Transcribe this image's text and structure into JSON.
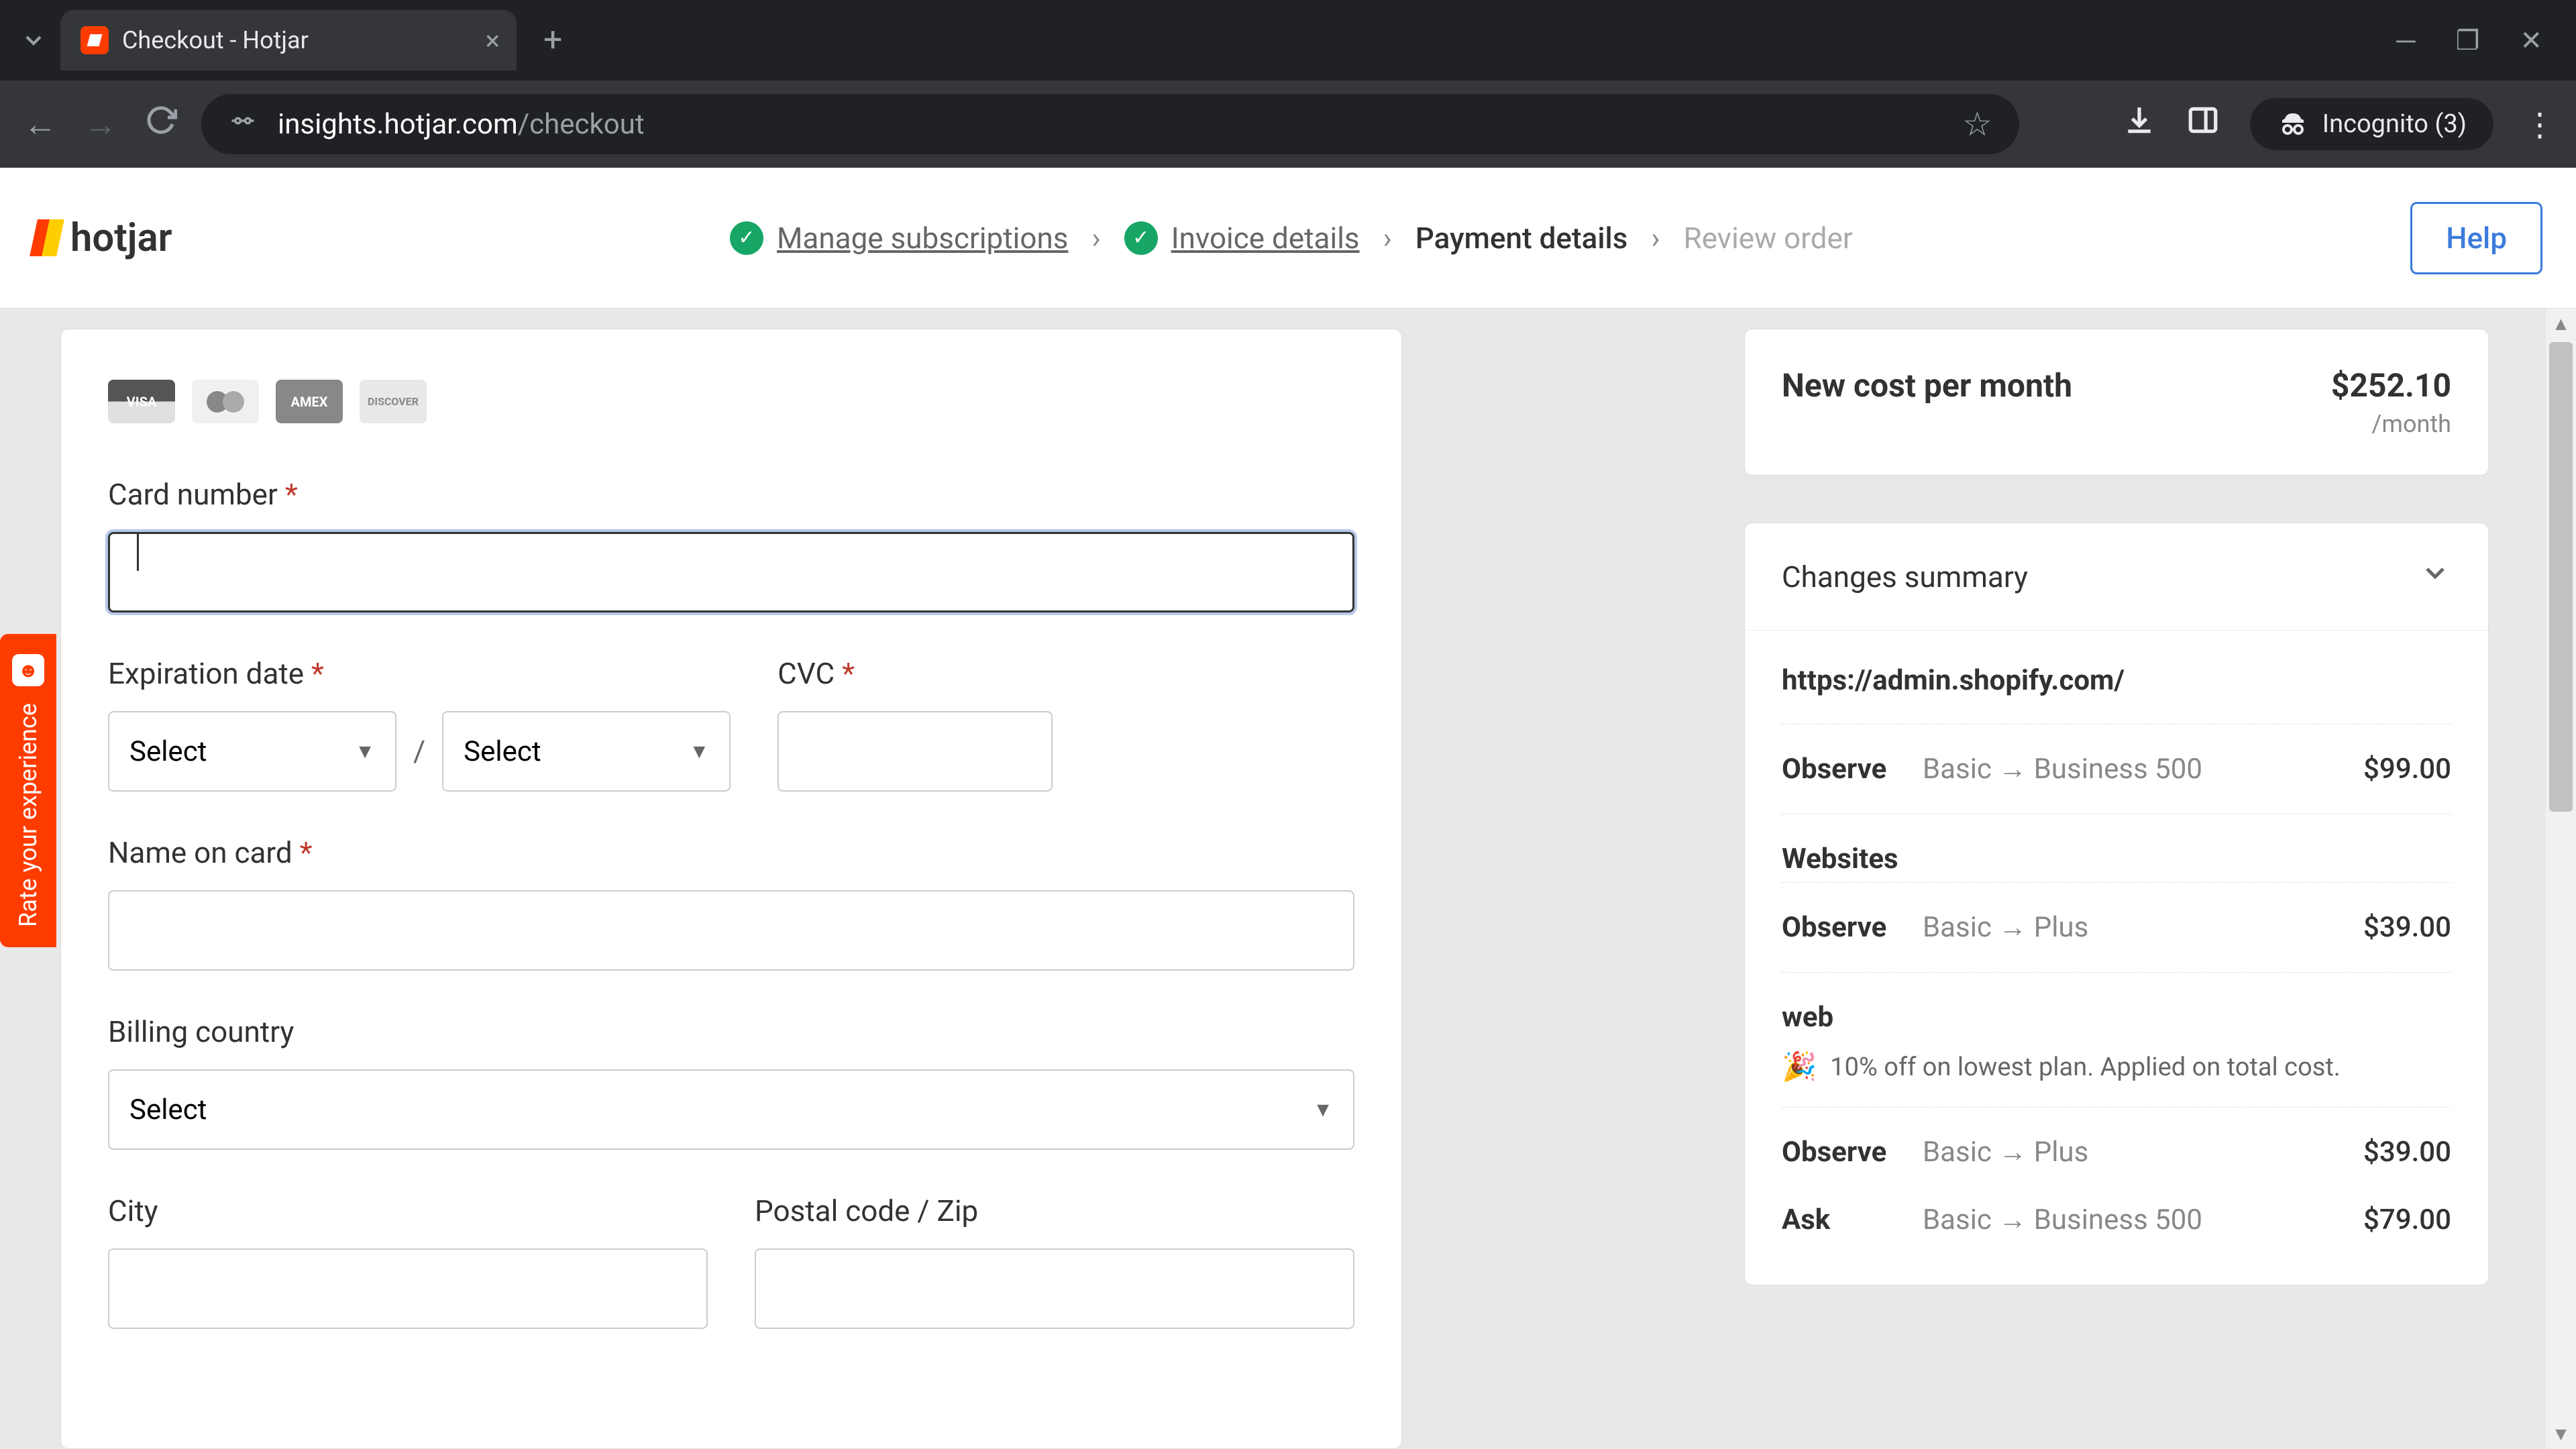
{
  "browser": {
    "tab_title": "Checkout - Hotjar",
    "url_domain": "insights.hotjar.com",
    "url_path": "/checkout",
    "incognito": "Incognito (3)"
  },
  "header": {
    "logo_text": "hotjar",
    "help": "Help",
    "crumbs": [
      {
        "label": "Manage subscriptions",
        "state": "done"
      },
      {
        "label": "Invoice details",
        "state": "done"
      },
      {
        "label": "Payment details",
        "state": "active"
      },
      {
        "label": "Review order",
        "state": "future"
      }
    ]
  },
  "feedback": "Rate your experience",
  "form": {
    "card_number_label": "Card number",
    "expiration_label": "Expiration date",
    "cvc_label": "CVC",
    "name_label": "Name on card",
    "country_label": "Billing country",
    "city_label": "City",
    "postal_label": "Postal code / Zip",
    "select_placeholder": "Select",
    "card_brands": [
      "VISA",
      "",
      "AMEX",
      "DISCOVER"
    ]
  },
  "summary": {
    "cost_label": "New cost per month",
    "cost_amount": "$252.10",
    "cost_period": "/month",
    "changes_title": "Changes summary",
    "sites": [
      {
        "url": "https://admin.shopify.com/",
        "rows": [
          {
            "plan": "Observe",
            "desc": "Basic → Business 500",
            "price": "$99.00"
          }
        ]
      },
      {
        "url": "Websites",
        "rows": [
          {
            "plan": "Observe",
            "desc": "Basic → Plus",
            "price": "$39.00"
          }
        ]
      },
      {
        "url": "web",
        "discount": "10% off on lowest plan. Applied on total cost.",
        "rows": [
          {
            "plan": "Observe",
            "desc": "Basic → Plus",
            "price": "$39.00"
          },
          {
            "plan": "Ask",
            "desc": "Basic → Business 500",
            "price": "$79.00"
          }
        ]
      }
    ]
  }
}
